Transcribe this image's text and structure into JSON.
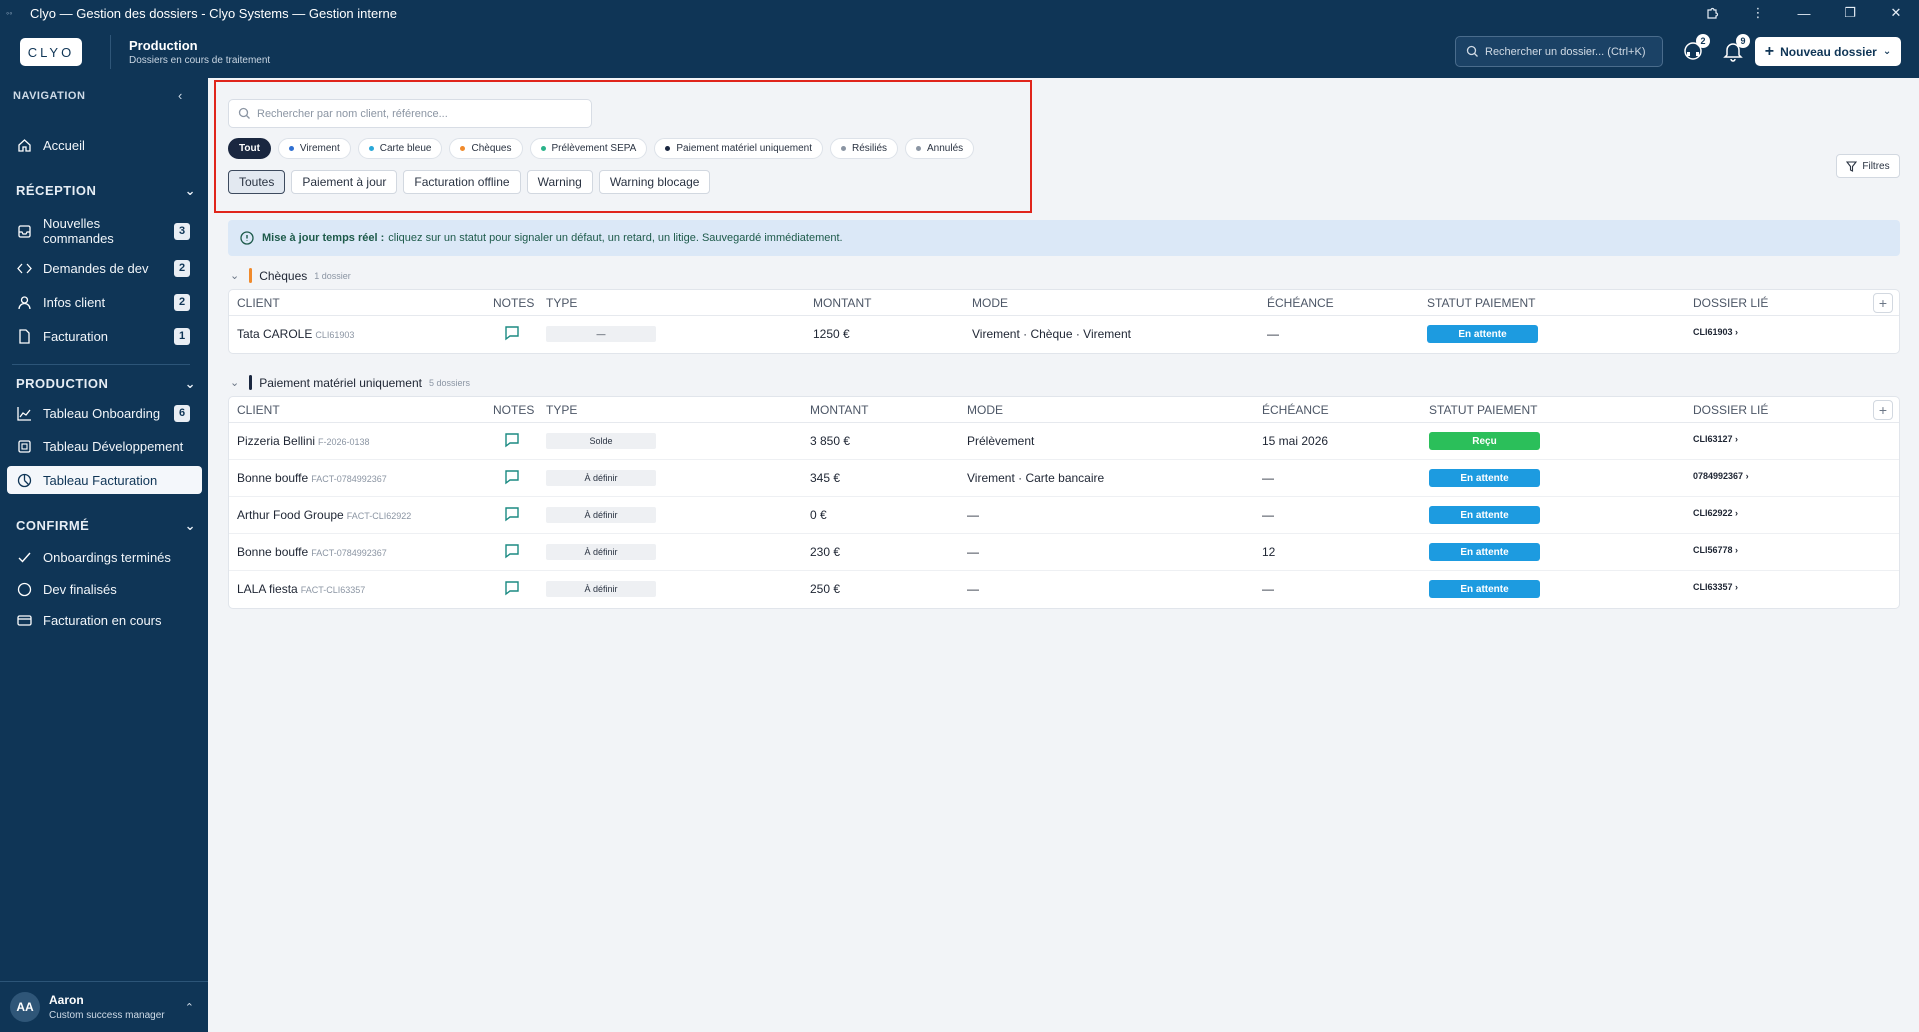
{
  "window": {
    "title": "Clyo — Gestion des dossiers - Clyo Systems — Gestion interne"
  },
  "header": {
    "logo_text": "CLYO",
    "title": "Production",
    "subtitle": "Dossiers en cours de traitement",
    "search_placeholder": "Rechercher un dossier...  (Ctrl+K)",
    "support_count": "2",
    "notif_count": "9",
    "new_button": "Nouveau dossier"
  },
  "sidebar": {
    "nav_heading": "NAVIGATION",
    "home": "Accueil",
    "reception": {
      "title": "RÉCEPTION",
      "items": [
        {
          "label": "Nouvelles commandes",
          "count": "3",
          "icon": "inbox-icon"
        },
        {
          "label": "Demandes de dev",
          "count": "2",
          "icon": "code-icon"
        },
        {
          "label": "Infos client",
          "count": "2",
          "icon": "user-icon"
        },
        {
          "label": "Facturation",
          "count": "1",
          "icon": "file-icon"
        }
      ]
    },
    "production": {
      "title": "PRODUCTION",
      "items": [
        {
          "label": "Tableau Onboarding",
          "count": "6",
          "icon": "chart-line-icon"
        },
        {
          "label": "Tableau Développement",
          "count": "",
          "icon": "square-icon"
        },
        {
          "label": "Tableau Facturation",
          "count": "",
          "icon": "gauge-icon",
          "active": true
        }
      ]
    },
    "confirme": {
      "title": "CONFIRMÉ",
      "items": [
        {
          "label": "Onboardings terminés",
          "icon": "check-icon"
        },
        {
          "label": "Dev finalisés",
          "icon": "circle-icon"
        },
        {
          "label": "Facturation en cours",
          "icon": "card-icon"
        }
      ]
    },
    "user": {
      "initials": "AA",
      "name": "Aaron",
      "role": "Custom success manager"
    }
  },
  "filters": {
    "search_placeholder": "Rechercher par nom client, référence...",
    "chips": [
      {
        "label": "Tout",
        "active": true,
        "color": ""
      },
      {
        "label": "Virement",
        "color": "#2f6fd1"
      },
      {
        "label": "Carte bleue",
        "color": "#2aa8d8"
      },
      {
        "label": "Chèques",
        "color": "#f08a2c"
      },
      {
        "label": "Prélèvement SEPA",
        "color": "#2bb38a"
      },
      {
        "label": "Paiement matériel uniquement",
        "color": "#1a2740"
      },
      {
        "label": "Résiliés",
        "color": "#8b95a3"
      },
      {
        "label": "Annulés",
        "color": "#8b95a3"
      }
    ],
    "tags": [
      {
        "label": "Toutes",
        "active": true
      },
      {
        "label": "Paiement à jour"
      },
      {
        "label": "Facturation offline"
      },
      {
        "label": "Warning"
      },
      {
        "label": "Warning blocage"
      }
    ],
    "filters_button": "Filtres"
  },
  "banner": {
    "strong": "Mise à jour temps réel :",
    "text": "cliquez sur un statut pour signaler un défaut, un retard, un litige. Sauvegardé immédiatement."
  },
  "columns": [
    "CLIENT",
    "NOTES",
    "TYPE",
    "MONTANT",
    "MODE",
    "ÉCHÉANCE",
    "STATUT PAIEMENT",
    "DOSSIER LIÉ"
  ],
  "groups": [
    {
      "title": "Chèques",
      "count_label": "1 dossier",
      "color": "#f08a2c",
      "rows": [
        {
          "client": "Tata CAROLE",
          "ref": "CLI61903",
          "type": "—",
          "amount": "1250 €",
          "mode": "Virement · Chèque · Virement",
          "due": "—",
          "status": "En attente",
          "status_color": "#1d9be0",
          "link": "CLI61903"
        }
      ]
    },
    {
      "title": "Paiement matériel uniquement",
      "count_label": "5 dossiers",
      "color": "#1a2740",
      "rows": [
        {
          "client": "Pizzeria Bellini",
          "ref": "F-2026-0138",
          "type": "Solde",
          "amount": "3 850 €",
          "mode": "Prélèvement",
          "due": "15 mai 2026",
          "status": "Reçu",
          "status_color": "#2bbf5a",
          "link": "CLI63127"
        },
        {
          "client": "Bonne bouffe",
          "ref": "FACT-0784992367",
          "type": "À définir",
          "amount": "345 €",
          "mode": "Virement · Carte bancaire",
          "due": "—",
          "status": "En attente",
          "status_color": "#1d9be0",
          "link": "0784992367"
        },
        {
          "client": "Arthur Food Groupe",
          "ref": "FACT-CLI62922",
          "type": "À définir",
          "amount": "0 €",
          "mode": "—",
          "due": "—",
          "status": "En attente",
          "status_color": "#1d9be0",
          "link": "CLI62922"
        },
        {
          "client": "Bonne bouffe",
          "ref": "FACT-0784992367",
          "type": "À définir",
          "amount": "230 €",
          "mode": "—",
          "due": "12",
          "status": "En attente",
          "status_color": "#1d9be0",
          "link": "CLI56778"
        },
        {
          "client": "LALA fiesta",
          "ref": "FACT-CLI63357",
          "type": "À définir",
          "amount": "250 €",
          "mode": "—",
          "due": "—",
          "status": "En attente",
          "status_color": "#1d9be0",
          "link": "CLI63357"
        }
      ]
    }
  ]
}
